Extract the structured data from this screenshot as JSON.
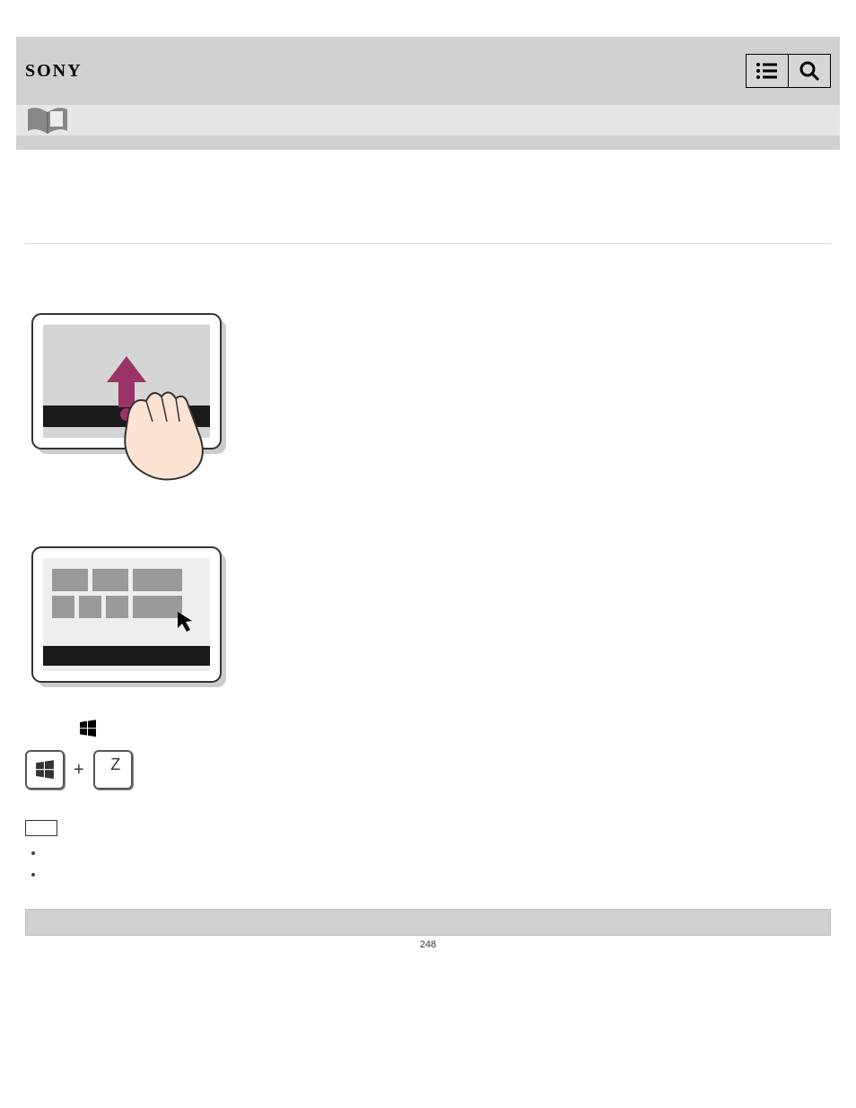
{
  "header": {
    "brand": "SONY"
  },
  "subheader": {
    "icon": "book-icon"
  },
  "content": {
    "windows_key_label": "Z",
    "plus": "+",
    "note_label": "",
    "bullets": [
      "",
      ""
    ]
  },
  "footer": {
    "page_number": "248"
  }
}
